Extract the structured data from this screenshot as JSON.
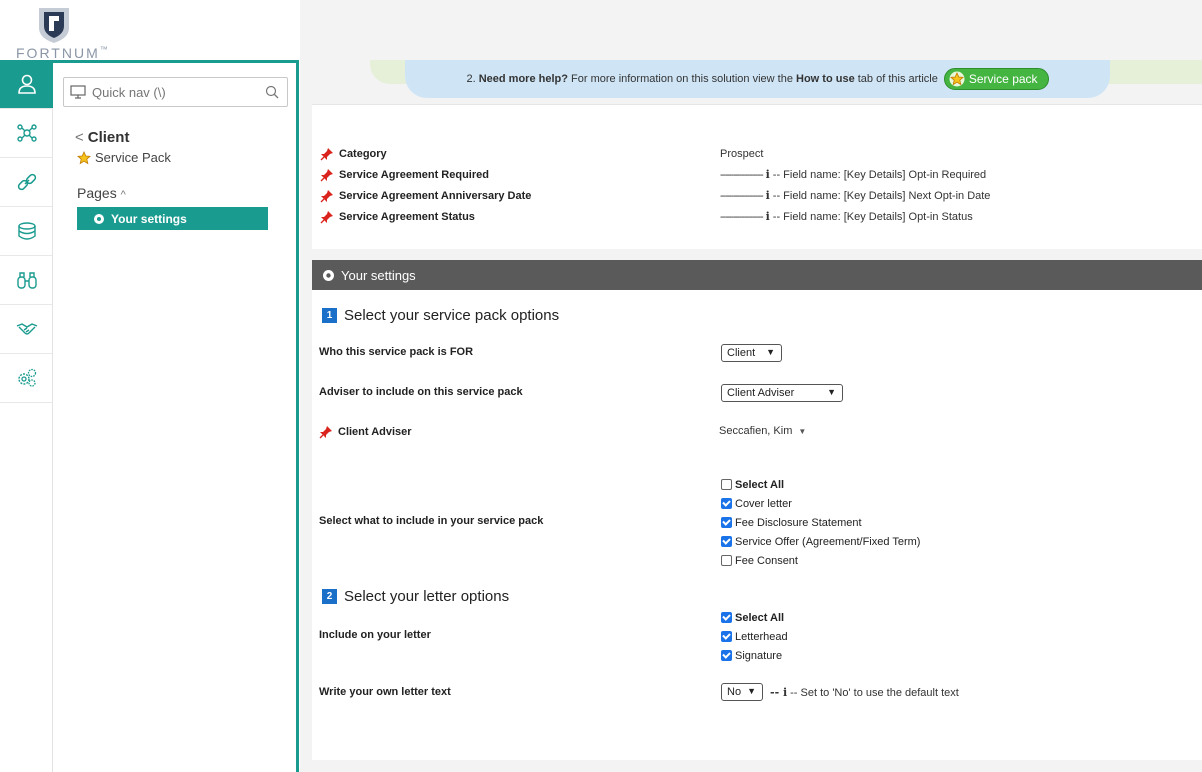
{
  "brand": {
    "name": "FORTNUM",
    "trademark": "™"
  },
  "rail": {
    "icons": [
      "user-icon",
      "network-icon",
      "link-icon",
      "coins-icon",
      "binoculars-icon",
      "handshake-icon",
      "settings-gears-icon"
    ]
  },
  "nav": {
    "search_placeholder": "Quick nav (\\)",
    "back_label": "Client",
    "back_chevron": "<",
    "sub_label": "Service Pack",
    "pages_label": "Pages",
    "pages_chevron": "^",
    "active_item": "Your settings"
  },
  "help": {
    "prefix": "2.",
    "bold1": "Need more help?",
    "text1": "For more information on this solution view the",
    "bold2": "How to use",
    "text2": "tab of this article",
    "pill": "Service pack"
  },
  "details": [
    {
      "label": "Category",
      "value": "Prospect",
      "dashes": "",
      "note": ""
    },
    {
      "label": "Service Agreement Required",
      "value": "",
      "dashes": "----------------",
      "note": "-- Field name: [Key Details] Opt-in Required"
    },
    {
      "label": "Service Agreement Anniversary Date",
      "value": "",
      "dashes": "----------------",
      "note": "-- Field name: [Key Details] Next Opt-in Date"
    },
    {
      "label": "Service Agreement Status",
      "value": "",
      "dashes": "----------------",
      "note": "-- Field name: [Key Details] Opt-in Status"
    }
  ],
  "settings": {
    "header": "Your settings",
    "section1": {
      "num": "1",
      "title": "Select your service pack options"
    },
    "for_label": "Who this service pack is FOR",
    "for_value": "Client",
    "adviser_label": "Adviser to include on this service pack",
    "adviser_value": "Client Adviser",
    "client_adviser_label": "Client Adviser",
    "client_adviser_value": "Seccafien, Kim",
    "include_label": "Select what to include in your service pack",
    "include_options": [
      {
        "label": "Select All",
        "checked": false,
        "bold": true
      },
      {
        "label": "Cover letter",
        "checked": true,
        "bold": false
      },
      {
        "label": "Fee Disclosure Statement",
        "checked": true,
        "bold": false
      },
      {
        "label": "Service Offer (Agreement/Fixed Term)",
        "checked": true,
        "bold": false
      },
      {
        "label": "Fee Consent",
        "checked": false,
        "bold": false
      }
    ],
    "section2": {
      "num": "2",
      "title": "Select your letter options"
    },
    "letter_label": "Include on your letter",
    "letter_options": [
      {
        "label": "Select All",
        "checked": true,
        "bold": true
      },
      {
        "label": "Letterhead",
        "checked": true,
        "bold": false
      },
      {
        "label": "Signature",
        "checked": true,
        "bold": false
      }
    ],
    "own_text_label": "Write your own letter text",
    "own_text_value": "No",
    "own_text_note": "-- Set to 'No' to use the default text"
  },
  "colors": {
    "accent": "#1a9b8f",
    "header": "#5a5a5a",
    "pill": "#45b542",
    "section": "#1a6fc9"
  }
}
